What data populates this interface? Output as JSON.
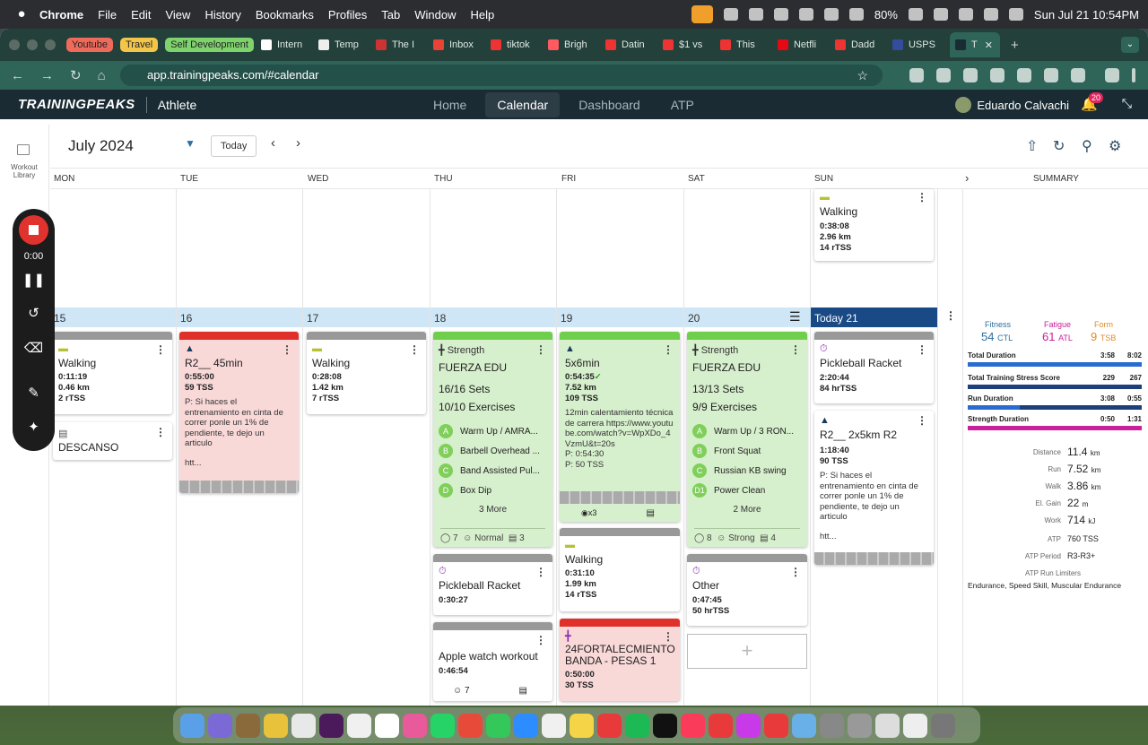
{
  "menubar": {
    "app": "Chrome",
    "items": [
      "File",
      "Edit",
      "View",
      "History",
      "Bookmarks",
      "Profiles",
      "Tab",
      "Window",
      "Help"
    ],
    "battery": "80%",
    "datetime": "Sun Jul 21  10:54PM"
  },
  "tabs": {
    "groups": [
      {
        "label": "Youtube",
        "color": "#f06a5b"
      },
      {
        "label": "Travel",
        "color": "#f3c64a"
      },
      {
        "label": "Self Development",
        "color": "#7fd36c"
      }
    ],
    "items": [
      "Intern",
      "Temp",
      "The I",
      "Inbox",
      "tiktok",
      "Brigh",
      "Datin",
      "$1 vs",
      "This",
      "Netfli",
      "Dadd",
      "USPS",
      "T"
    ]
  },
  "address": {
    "url": "app.trainingpeaks.com/#calendar"
  },
  "header": {
    "logo": "TRAININGPEAKS",
    "role": "Athlete",
    "nav": [
      "Home",
      "Calendar",
      "Dashboard",
      "ATP"
    ],
    "active_nav": "Calendar",
    "user": "Eduardo Calvachi",
    "notifications": "20"
  },
  "rail": {
    "workout_library": "Workout Library"
  },
  "recorder": {
    "time": "0:00"
  },
  "calendar": {
    "month": "July 2024",
    "today_button": "Today",
    "days": [
      "MON",
      "TUE",
      "WED",
      "THU",
      "FRI",
      "SAT",
      "SUN"
    ],
    "summary_label": "SUMMARY",
    "dates": [
      "15",
      "16",
      "17",
      "18",
      "19",
      "20",
      "Today 21"
    ]
  },
  "prev_week": {
    "sun": {
      "title": "Walking",
      "duration": "0:38:08",
      "distance": "2.96 km",
      "tss": "14 rTSS"
    }
  },
  "week": {
    "mon": [
      {
        "title": "Walking",
        "duration": "0:11:19",
        "distance": "0.46 km",
        "tss": "2 rTSS"
      },
      {
        "title": "DESCANSO"
      }
    ],
    "tue": {
      "title": "R2__ 45min",
      "duration": "0:55:00",
      "tss": "59 TSS",
      "desc": "P: Si haces el entrenamiento en cinta de correr ponle un 1% de pendiente, te dejo un articulo",
      "more": "htt..."
    },
    "wed": {
      "title": "Walking",
      "duration": "0:28:08",
      "distance": "1.42 km",
      "tss": "7 rTSS"
    },
    "thu": [
      {
        "type": "Strength",
        "title": "FUERZA EDU",
        "sets": "16/16 Sets",
        "exercises": "10/10 Exercises",
        "list": [
          {
            "k": "A",
            "n": "Warm Up / AMRA..."
          },
          {
            "k": "B",
            "n": "Barbell Overhead ..."
          },
          {
            "k": "C",
            "n": "Band Assisted Pul..."
          },
          {
            "k": "D",
            "n": "Box Dip"
          }
        ],
        "more": "3 More",
        "rpe": "7",
        "feel": "Normal",
        "comments": "3"
      },
      {
        "title": "Pickleball Racket",
        "duration": "0:30:27"
      },
      {
        "title": "Apple watch workout",
        "duration": "0:46:54",
        "rpe": "7"
      }
    ],
    "fri": [
      {
        "title": "5x6min",
        "duration": "0:54:35",
        "distance": "7.52 km",
        "tss": "109 TSS",
        "desc": "12min calentamiento técnica de carrera https://www.youtube.com/watch?v=WpXDo_4VzmU&t=20s",
        "planned_dur": "P: 0:54:30",
        "planned_tss": "P: 50 TSS",
        "laps": "x3"
      },
      {
        "title": "Walking",
        "duration": "0:31:10",
        "distance": "1.99 km",
        "tss": "14 rTSS"
      },
      {
        "title": "24FORTALECMIENTO BANDA - PESAS 1",
        "duration": "0:50:00",
        "tss": "30 TSS"
      }
    ],
    "sat": [
      {
        "type": "Strength",
        "title": "FUERZA EDU",
        "sets": "13/13 Sets",
        "exercises": "9/9 Exercises",
        "list": [
          {
            "k": "A",
            "n": "Warm Up / 3 RON..."
          },
          {
            "k": "B",
            "n": "Front Squat"
          },
          {
            "k": "C",
            "n": "Russian KB swing"
          },
          {
            "k": "D1",
            "n": "Power Clean"
          }
        ],
        "more": "2 More",
        "rpe": "8",
        "feel": "Strong",
        "comments": "4"
      },
      {
        "title": "Other",
        "duration": "0:47:45",
        "tss": "50 hrTSS"
      }
    ],
    "sun": [
      {
        "title": "Pickleball Racket",
        "duration": "2:20:44",
        "tss": "84 hrTSS"
      },
      {
        "title": "R2__ 2x5km R2",
        "duration": "1:18:40",
        "tss": "90 TSS",
        "desc": "P: Si haces el entrenamiento en cinta de correr ponle un 1% de pendiente, te dejo un articulo",
        "more": "htt..."
      }
    ]
  },
  "summary": {
    "fitness_label": "Fitness",
    "fitness": "54",
    "fitness_unit": "CTL",
    "fatigue_label": "Fatigue",
    "fatigue": "61",
    "fatigue_unit": "ATL",
    "form_label": "Form",
    "form": "9",
    "form_unit": "TSB",
    "rows": [
      {
        "label": "Total Duration",
        "planned": "3:58",
        "actual": "8:02",
        "fill": 1.0,
        "color": "#2a6bd1"
      },
      {
        "label": "Total Training Stress Score",
        "planned": "229",
        "actual": "267",
        "fill": 1.0,
        "color": "#1d3f7c"
      },
      {
        "label": "Run Duration",
        "planned": "3:08",
        "actual": "0:55",
        "fill": 0.3,
        "color": "#2a6bd1"
      },
      {
        "label": "Strength Duration",
        "planned": "0:50",
        "actual": "1:31",
        "fill": 1.0,
        "color": "#c9209b"
      }
    ],
    "stats": [
      {
        "label": "Distance",
        "value": "11.4",
        "unit": "km"
      },
      {
        "label": "Run",
        "value": "7.52",
        "unit": "km"
      },
      {
        "label": "Walk",
        "value": "3.86",
        "unit": "km"
      },
      {
        "label": "El. Gain",
        "value": "22",
        "unit": "m"
      },
      {
        "label": "Work",
        "value": "714",
        "unit": "kJ"
      },
      {
        "label": "ATP",
        "value": "760",
        "unit": "TSS"
      },
      {
        "label": "ATP Period",
        "value": "R3-R3+",
        "unit": ""
      }
    ],
    "limiters_label": "ATP Run Limiters",
    "limiters": "Endurance, Speed Skill, Muscular Endurance"
  }
}
